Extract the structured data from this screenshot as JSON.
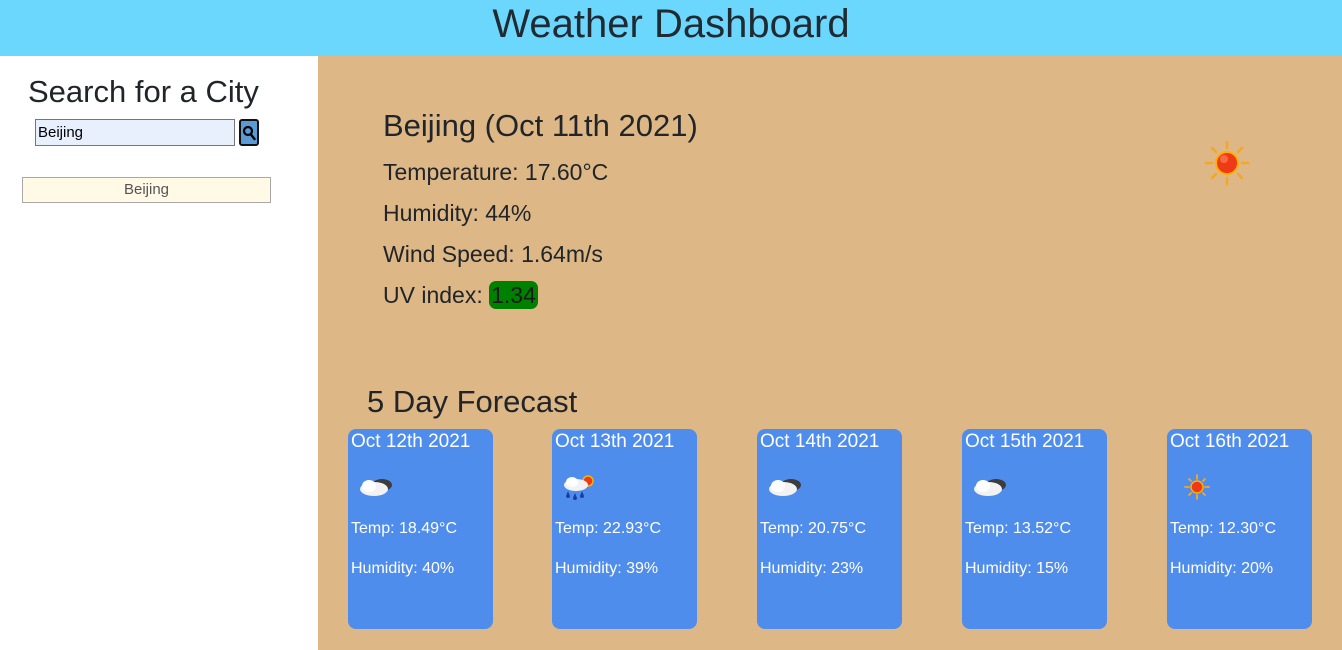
{
  "header": {
    "title": "Weather Dashboard"
  },
  "sidebar": {
    "title": "Search for a City",
    "search": {
      "value": "Beijing"
    },
    "history": [
      "Beijing"
    ]
  },
  "current": {
    "title": "Beijing (Oct 11th 2021)",
    "temperature": "Temperature: 17.60°C",
    "humidity": "Humidity: 44%",
    "wind": "Wind Speed: 1.64m/s",
    "uv_label": "UV index: ",
    "uv_value": "1.34",
    "icon": "sun-icon",
    "uv_color": "#008000"
  },
  "forecast": {
    "title": "5 Day Forecast",
    "days": [
      {
        "date": "Oct 12th 2021",
        "icon": "cloudy-icon",
        "temp": "Temp: 18.49°C",
        "humidity": "Humidity: 40%"
      },
      {
        "date": "Oct 13th 2021",
        "icon": "rain-sun-icon",
        "temp": "Temp: 22.93°C",
        "humidity": "Humidity: 39%"
      },
      {
        "date": "Oct 14th 2021",
        "icon": "cloudy-icon",
        "temp": "Temp: 20.75°C",
        "humidity": "Humidity: 23%"
      },
      {
        "date": "Oct 15th 2021",
        "icon": "cloudy-icon",
        "temp": "Temp: 13.52°C",
        "humidity": "Humidity: 15%"
      },
      {
        "date": "Oct 16th 2021",
        "icon": "sun-icon",
        "temp": "Temp: 12.30°C",
        "humidity": "Humidity: 20%"
      }
    ]
  },
  "colors": {
    "header_bg": "#6cd7fd",
    "main_bg": "#ddb886",
    "card_bg": "#4f8ded",
    "history_bg": "#fff9e6"
  }
}
